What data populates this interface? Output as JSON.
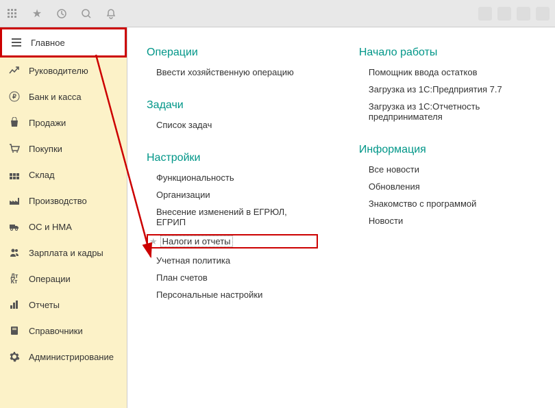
{
  "sidebar": {
    "active": "Главное",
    "items": [
      {
        "label": "Руководителю"
      },
      {
        "label": "Банк и касса"
      },
      {
        "label": "Продажи"
      },
      {
        "label": "Покупки"
      },
      {
        "label": "Склад"
      },
      {
        "label": "Производство"
      },
      {
        "label": "ОС и НМА"
      },
      {
        "label": "Зарплата и кадры"
      },
      {
        "label": "Операции"
      },
      {
        "label": "Отчеты"
      },
      {
        "label": "Справочники"
      },
      {
        "label": "Администрирование"
      }
    ]
  },
  "main": {
    "col1": {
      "s1": {
        "title": "Операции",
        "items": [
          "Ввести хозяйственную операцию"
        ]
      },
      "s2": {
        "title": "Задачи",
        "items": [
          "Список задач"
        ]
      },
      "s3": {
        "title": "Настройки",
        "items": [
          "Функциональность",
          "Организации",
          "Внесение изменений в ЕГРЮЛ, ЕГРИП",
          "Налоги и отчеты",
          "Учетная политика",
          "План счетов",
          "Персональные настройки"
        ]
      }
    },
    "col2": {
      "s1": {
        "title": "Начало работы",
        "items": [
          "Помощник ввода остатков",
          "Загрузка из 1С:Предприятия 7.7",
          "Загрузка из 1С:Отчетность предпринимателя"
        ]
      },
      "s2": {
        "title": "Информация",
        "items": [
          "Все новости",
          "Обновления",
          "Знакомство с программой",
          "Новости"
        ]
      }
    }
  }
}
